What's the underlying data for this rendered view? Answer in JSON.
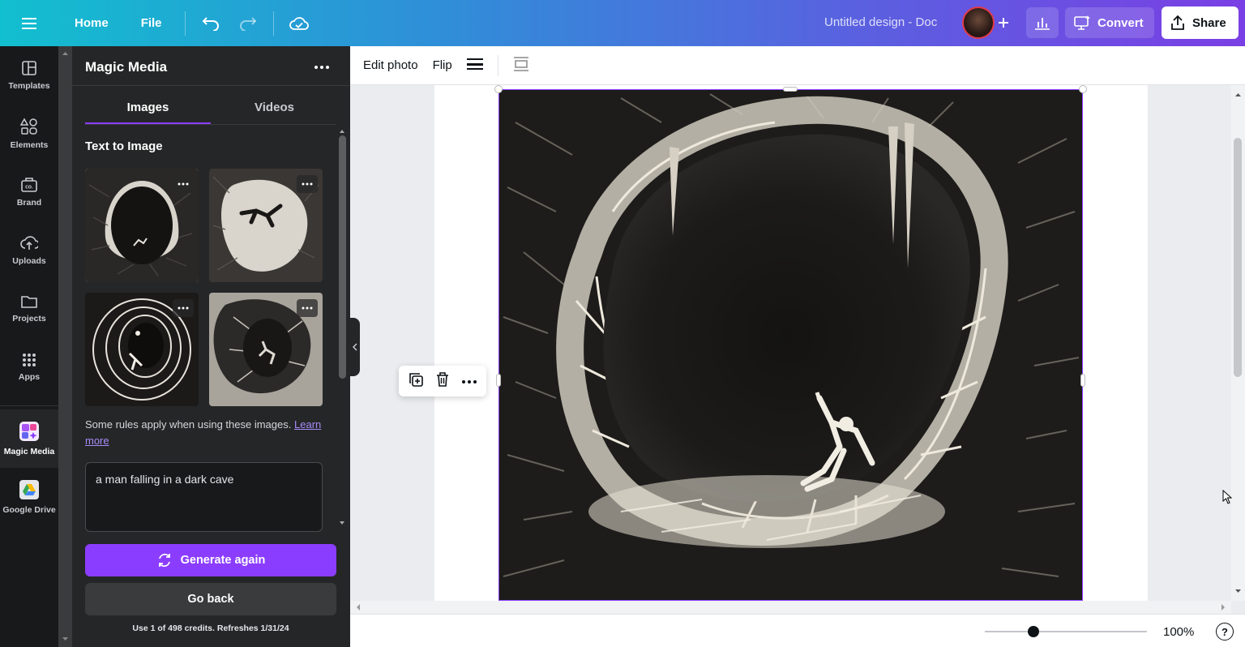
{
  "colors": {
    "accent": "#8b3dff",
    "rail_bg": "#18191b",
    "panel_bg": "#252627"
  },
  "topbar": {
    "home_label": "Home",
    "file_label": "File",
    "doc_title": "Untitled design - Doc",
    "convert_label": "Convert",
    "share_label": "Share"
  },
  "rail": {
    "items": [
      {
        "label": "Templates",
        "icon": "templates-icon"
      },
      {
        "label": "Elements",
        "icon": "elements-icon"
      },
      {
        "label": "Brand",
        "icon": "brand-icon"
      },
      {
        "label": "Uploads",
        "icon": "uploads-icon"
      },
      {
        "label": "Projects",
        "icon": "projects-icon"
      },
      {
        "label": "Apps",
        "icon": "apps-icon"
      },
      {
        "label": "Magic Media",
        "icon": "magic-media-icon"
      },
      {
        "label": "Google Drive",
        "icon": "google-drive-icon"
      }
    ]
  },
  "panel": {
    "title": "Magic Media",
    "tabs": [
      {
        "label": "Images"
      },
      {
        "label": "Videos"
      }
    ],
    "section_title": "Text to Image",
    "rules_text": "Some rules apply when using these images.",
    "learn_more": "Learn more",
    "prompt": "a man falling in a dark cave",
    "generate_label": "Generate again",
    "back_label": "Go back",
    "credits_text": "Use 1 of 498 credits. Refreshes 1/31/24"
  },
  "context_toolbar": {
    "edit_photo_label": "Edit photo",
    "flip_label": "Flip"
  },
  "footer": {
    "zoom_value": "100%",
    "help_label": "?"
  }
}
